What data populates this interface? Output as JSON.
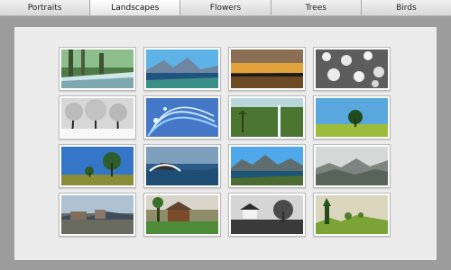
{
  "tabs": [
    {
      "label": "Portraits",
      "active": false
    },
    {
      "label": "Landscapes",
      "active": true
    },
    {
      "label": "Flowers",
      "active": false
    },
    {
      "label": "Trees",
      "active": false
    },
    {
      "label": "Birds",
      "active": false
    }
  ],
  "colors": {
    "page_background": "#9c9c9c",
    "panel_background": "#ececec",
    "tab_background": "#e0e0e0"
  },
  "gallery": {
    "rows": 4,
    "columns": 4,
    "thumbnails": [
      {
        "subject": "forest-stream"
      },
      {
        "subject": "coastal-bay"
      },
      {
        "subject": "sunset-lake"
      },
      {
        "subject": "snowy-rocks"
      },
      {
        "subject": "frosted-trees"
      },
      {
        "subject": "digital-waves"
      },
      {
        "subject": "waterfall"
      },
      {
        "subject": "lone-tree-field"
      },
      {
        "subject": "savanna-trees"
      },
      {
        "subject": "ocean-wave-rock"
      },
      {
        "subject": "mountain-lake"
      },
      {
        "subject": "misty-valley"
      },
      {
        "subject": "rocky-shore"
      },
      {
        "subject": "cottage-garden"
      },
      {
        "subject": "farmhouse-tree"
      },
      {
        "subject": "green-hills"
      }
    ]
  }
}
